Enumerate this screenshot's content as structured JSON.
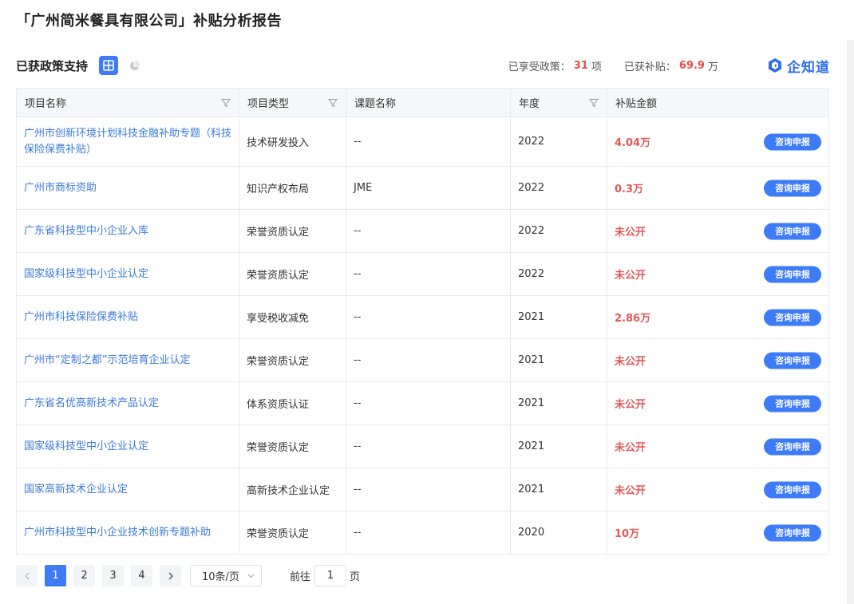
{
  "page_title": "「广州简米餐具有限公司」补贴分析报告",
  "section": {
    "title": "已获政策支持",
    "view_grid_icon": "grid-icon",
    "view_pie_icon": "pie-chart-icon"
  },
  "stats": {
    "policies_label": "已享受政策：",
    "policies_count": "31",
    "policies_unit": "项",
    "subsidy_label": "已获补贴：",
    "subsidy_amount": "69.9",
    "subsidy_unit": "万"
  },
  "logo": {
    "text": "企知道",
    "icon": "logo-icon",
    "brand_color": "#2c6ef2"
  },
  "table": {
    "headers": [
      "项目名称",
      "项目类型",
      "课题名称",
      "年度",
      "补贴金额"
    ],
    "rows": [
      {
        "name": "广州市创新环境计划科技金融补助专题（科技保险保费补贴）",
        "type": "技术研发投入",
        "topic": "--",
        "year": "2022",
        "amount": "4.04万",
        "action": "咨询申报"
      },
      {
        "name": "广州市商标资助",
        "type": "知识产权布局",
        "topic": "JME",
        "year": "2022",
        "amount": "0.3万",
        "action": "咨询申报"
      },
      {
        "name": "广东省科技型中小企业入库",
        "type": "荣誉资质认定",
        "topic": "--",
        "year": "2022",
        "amount": "未公开",
        "action": "咨询申报"
      },
      {
        "name": "国家级科技型中小企业认定",
        "type": "荣誉资质认定",
        "topic": "--",
        "year": "2022",
        "amount": "未公开",
        "action": "咨询申报"
      },
      {
        "name": "广州市科技保险保费补贴",
        "type": "享受税收减免",
        "topic": "--",
        "year": "2021",
        "amount": "2.86万",
        "action": "咨询申报"
      },
      {
        "name": "广州市“定制之都”示范培育企业认定",
        "type": "荣誉资质认定",
        "topic": "--",
        "year": "2021",
        "amount": "未公开",
        "action": "咨询申报"
      },
      {
        "name": "广东省名优高新技术产品认定",
        "type": "体系资质认证",
        "topic": "--",
        "year": "2021",
        "amount": "未公开",
        "action": "咨询申报"
      },
      {
        "name": "国家级科技型中小企业认定",
        "type": "荣誉资质认定",
        "topic": "--",
        "year": "2021",
        "amount": "未公开",
        "action": "咨询申报"
      },
      {
        "name": "国家高新技术企业认定",
        "type": "高新技术企业认定",
        "topic": "--",
        "year": "2021",
        "amount": "未公开",
        "action": "咨询申报"
      },
      {
        "name": "广州市科技型中小企业技术创新专题补助",
        "type": "荣誉资质认定",
        "topic": "--",
        "year": "2020",
        "amount": "10万",
        "action": "咨询申报"
      }
    ]
  },
  "pagination": {
    "pages": [
      "1",
      "2",
      "3",
      "4"
    ],
    "current": "1",
    "page_size": "10条/页",
    "goto_prefix": "前往",
    "goto_value": "1",
    "goto_suffix": "页"
  },
  "colors": {
    "accent": "#3d7bf7",
    "link": "#3a7bdc",
    "amount": "#e25858"
  }
}
